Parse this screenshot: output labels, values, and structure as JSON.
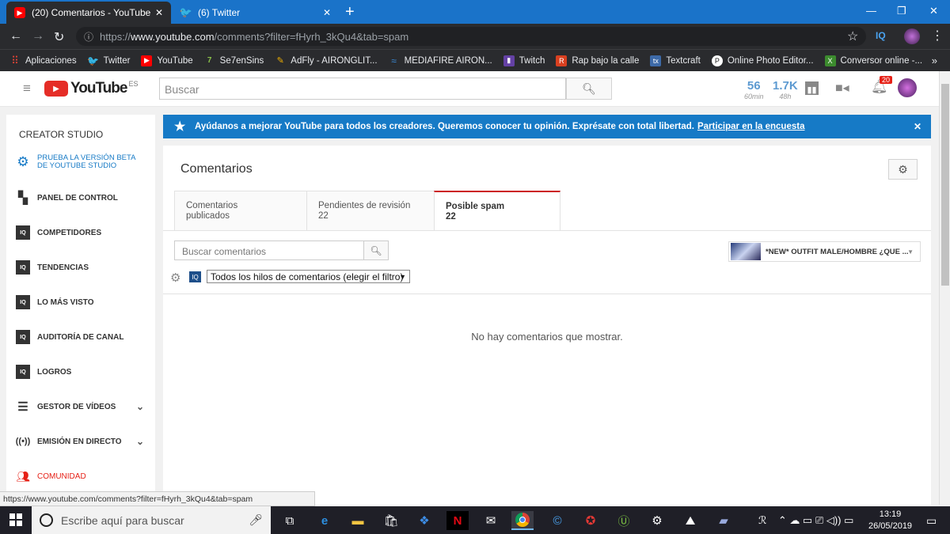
{
  "browser": {
    "tabs": [
      {
        "title": "(20) Comentarios - YouTube",
        "active": true
      },
      {
        "title": "(6) Twitter",
        "active": false
      }
    ],
    "url_prefix": "https://",
    "url_domain": "www.youtube.com",
    "url_path": "/comments?filter=fHyrh_3kQu4&tab=spam",
    "extension_iq": "IQ",
    "bookmarks": [
      {
        "label": "Aplicaciones",
        "icon": "apps-grid-icon",
        "color": "#ea4335"
      },
      {
        "label": "Twitter",
        "icon": "twitter-icon",
        "color": "#1da1f2"
      },
      {
        "label": "YouTube",
        "icon": "youtube-icon",
        "color": "#ff0000"
      },
      {
        "label": "Se7enSins",
        "icon": "se7ensins-icon",
        "color": "#4a8a2a"
      },
      {
        "label": "AdFly - AIRONGLIT...",
        "icon": "adfly-icon",
        "color": "#f0b000"
      },
      {
        "label": "MEDIAFIRE AIRON...",
        "icon": "mediafire-icon",
        "color": "#3a8dde"
      },
      {
        "label": "Twitch",
        "icon": "twitch-icon",
        "color": "#6441a5"
      },
      {
        "label": "Rap bajo la calle",
        "icon": "rap-icon",
        "color": "#d94020"
      },
      {
        "label": "Textcraft",
        "icon": "textcraft-icon",
        "color": "#3d6aa8"
      },
      {
        "label": "Online Photo Editor...",
        "icon": "photo-editor-icon",
        "color": "#444"
      },
      {
        "label": "Conversor online -...",
        "icon": "conversor-icon",
        "color": "#3c8b2e"
      }
    ]
  },
  "youtube": {
    "logo_word": "YouTube",
    "logo_region": "ES",
    "search_placeholder": "Buscar",
    "stat_views": {
      "value": "56",
      "label": "60min"
    },
    "stat_subs": {
      "value": "1.7K",
      "label": "48h"
    },
    "notification_count": "20"
  },
  "sidebar": {
    "header": "CREATOR STUDIO",
    "items": [
      {
        "label": "PRUEBA LA VERSIÓN BETA DE YOUTUBE STUDIO",
        "icon": "gear-icon"
      },
      {
        "label": "PANEL DE CONTROL",
        "icon": "dashboard-icon"
      },
      {
        "label": "COMPETIDORES",
        "icon": "vidiq-icon"
      },
      {
        "label": "TENDENCIAS",
        "icon": "vidiq-icon"
      },
      {
        "label": "LO MÁS VISTO",
        "icon": "vidiq-icon"
      },
      {
        "label": "AUDITORÍA DE CANAL",
        "icon": "vidiq-icon"
      },
      {
        "label": "LOGROS",
        "icon": "vidiq-icon"
      },
      {
        "label": "GESTOR DE VÍDEOS",
        "icon": "video-manager-icon"
      },
      {
        "label": "EMISIÓN EN DIRECTO",
        "icon": "live-icon"
      },
      {
        "label": "COMUNIDAD",
        "icon": "community-icon"
      }
    ],
    "accent_color": "#167ac6",
    "community_color": "#e62117"
  },
  "banner": {
    "text": "Ayúdanos a mejorar YouTube para todos los creadores. Queremos conocer tu opinión. Exprésate con total libertad.",
    "link": "Participar en la encuesta",
    "color": "#167ac6"
  },
  "comments": {
    "title": "Comentarios",
    "tabs": [
      {
        "label": "Comentarios publicados",
        "count": ""
      },
      {
        "label": "Pendientes de revisión",
        "count": "22"
      },
      {
        "label": "Posible spam",
        "count": "22"
      }
    ],
    "search_placeholder": "Buscar comentarios",
    "video_title": "*NEW* OUTFIT MALE/HOMBRE ¿QUE ...",
    "filter_iq": "IQ",
    "filter_option": "Todos los hilos de comentarios (elegir el filtro)",
    "empty_message": "No hay comentarios que mostrar."
  },
  "status_bar_url": "https://www.youtube.com/comments?filter=fHyrh_3kQu4&tab=spam",
  "taskbar": {
    "search_placeholder": "Escribe aquí para buscar",
    "time": "13:19",
    "date": "26/05/2019"
  }
}
